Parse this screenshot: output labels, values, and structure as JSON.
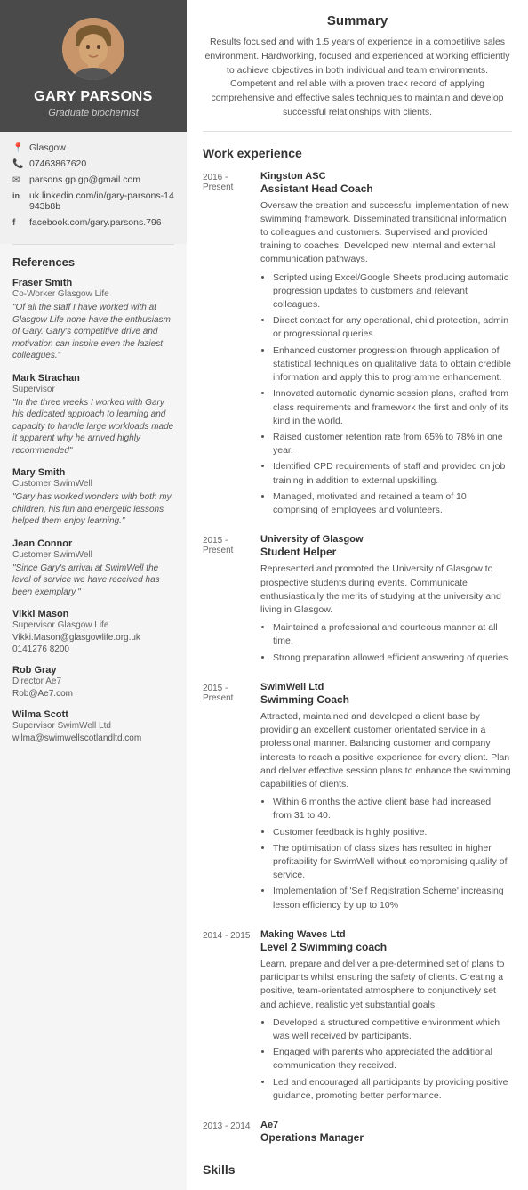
{
  "sidebar": {
    "name": "GARY PARSONS",
    "title": "Graduate biochemist",
    "location": "Glasgow",
    "phone": "07463867620",
    "email": "parsons.gp.gp@gmail.com",
    "linkedin": "uk.linkedin.com/in/gary-parsons-14943b8b",
    "facebook": "facebook.com/gary.parsons.796",
    "references_heading": "References",
    "references": [
      {
        "name": "Fraser Smith",
        "role": "Co-Worker Glasgow Life",
        "quote": "\"Of all the staff I have worked with at Glasgow Life none have the enthusiasm of Gary. Gary's competitive drive and motivation can inspire even the laziest colleagues.\""
      },
      {
        "name": "Mark Strachan",
        "role": "Supervisor",
        "quote": "\"In the three weeks I worked with Gary his dedicated approach to learning and capacity to handle large workloads made it apparent why he arrived highly recommended\""
      },
      {
        "name": "Mary Smith",
        "role": "Customer SwimWell",
        "quote": "\"Gary has worked wonders with both my children, his fun and energetic lessons helped them enjoy learning.\""
      },
      {
        "name": "Jean Connor",
        "role": "Customer SwimWell",
        "quote": "\"Since Gary's arrival at SwimWell the level of service we have received has been exemplary.\""
      },
      {
        "name": "Vikki Mason",
        "role": "Supervisor Glasgow Life",
        "contact1": "Vikki.Mason@glasgowlife.org.uk",
        "contact2": "0141276 8200"
      },
      {
        "name": "Rob Gray",
        "role": "Director Ae7",
        "contact1": "Rob@Ae7.com"
      },
      {
        "name": "Wilma Scott",
        "role": "Supervisor SwimWell Ltd",
        "contact1": "wilma@swimwellscotlandltd.com"
      }
    ]
  },
  "main": {
    "summary_heading": "Summary",
    "summary_text": "Results focused and with 1.5 years of experience in a competitive sales environment. Hardworking, focused and experienced at working efficiently to achieve objectives in both individual and team environments. Competent and reliable with a proven track record of applying comprehensive and effective sales techniques to maintain and develop successful relationships with clients.",
    "work_heading": "Work experience",
    "jobs": [
      {
        "dates": "2016 -\nPresent",
        "company": "Kingston ASC",
        "role": "Assistant Head Coach",
        "desc": "Oversaw the creation and successful implementation of new swimming framework. Disseminated transitional information to colleagues and customers. Supervised and provided training to coaches. Developed new internal and external communication pathways.",
        "bullets": [
          "Scripted using Excel/Google Sheets producing automatic progression updates to customers and relevant colleagues.",
          "Direct contact for any operational, child protection, admin or progressional queries.",
          "Enhanced customer progression through application of statistical techniques on qualitative data to obtain credible information and apply this to programme enhancement.",
          "Innovated automatic dynamic session plans, crafted from class requirements and framework the first and only of its kind in the world.",
          "Raised customer retention rate from 65% to 78% in one year.",
          "Identified CPD requirements of staff and provided on job training in addition to external upskilling.",
          "Managed, motivated and retained a team of 10 comprising of employees and volunteers."
        ]
      },
      {
        "dates": "2015 -\nPresent",
        "company": "University of Glasgow",
        "role": "Student Helper",
        "desc": "Represented and promoted the University of Glasgow to prospective students during events. Communicate enthusiastically the merits of studying at the university and living in Glasgow.",
        "bullets": [
          "Maintained a professional and courteous manner at all time.",
          "Strong preparation allowed efficient answering of queries."
        ]
      },
      {
        "dates": "2015 -\nPresent",
        "company": "SwimWell Ltd",
        "role": "Swimming Coach",
        "desc": "Attracted, maintained and developed a client base by providing an excellent customer orientated service in a professional manner. Balancing customer and company interests to reach a positive experience for every client. Plan and deliver effective session plans to enhance the swimming capabilities of clients.",
        "bullets": [
          "Within 6 months the active client base had increased from 31 to 40.",
          "Customer feedback is highly positive.",
          "The optimisation of class sizes has resulted in higher profitability for SwimWell without compromising quality of service.",
          "Implementation of 'Self Registration Scheme' increasing lesson efficiency by up to 10%"
        ]
      },
      {
        "dates": "2014 - 2015",
        "company": "Making Waves Ltd",
        "role": "Level 2 Swimming coach",
        "desc": "Learn, prepare and deliver a pre-determined set of plans to participants whilst ensuring the safety of clients. Creating a positive, team-orientated atmosphere to conjunctively set and achieve, realistic yet substantial goals.",
        "bullets": [
          "Developed a structured competitive environment which was well received by participants.",
          "Engaged with parents who appreciated the additional communication they received.",
          "Led and encouraged all participants by providing positive guidance, promoting better performance."
        ]
      },
      {
        "dates": "2013 - 2014",
        "company": "Ae7",
        "role": "Operations Manager",
        "desc": "",
        "bullets": []
      }
    ],
    "skills_heading": "Skills"
  }
}
